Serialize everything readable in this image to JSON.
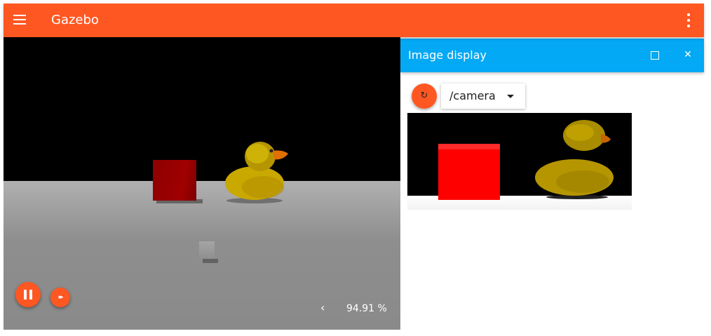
{
  "app": {
    "title": "Gazebo"
  },
  "scene": {
    "real_time_factor": "94.91 %",
    "toggle_glyph": "‹",
    "step_glyph": "▸▸"
  },
  "image_display": {
    "title": "Image display",
    "topic": "/camera",
    "close_glyph": "✕",
    "refresh_glyph": "↻"
  },
  "colors": {
    "primary": "#ff5722",
    "panel_header": "#03a9f4",
    "duck": "#d4b400",
    "box": "#ff0000"
  }
}
